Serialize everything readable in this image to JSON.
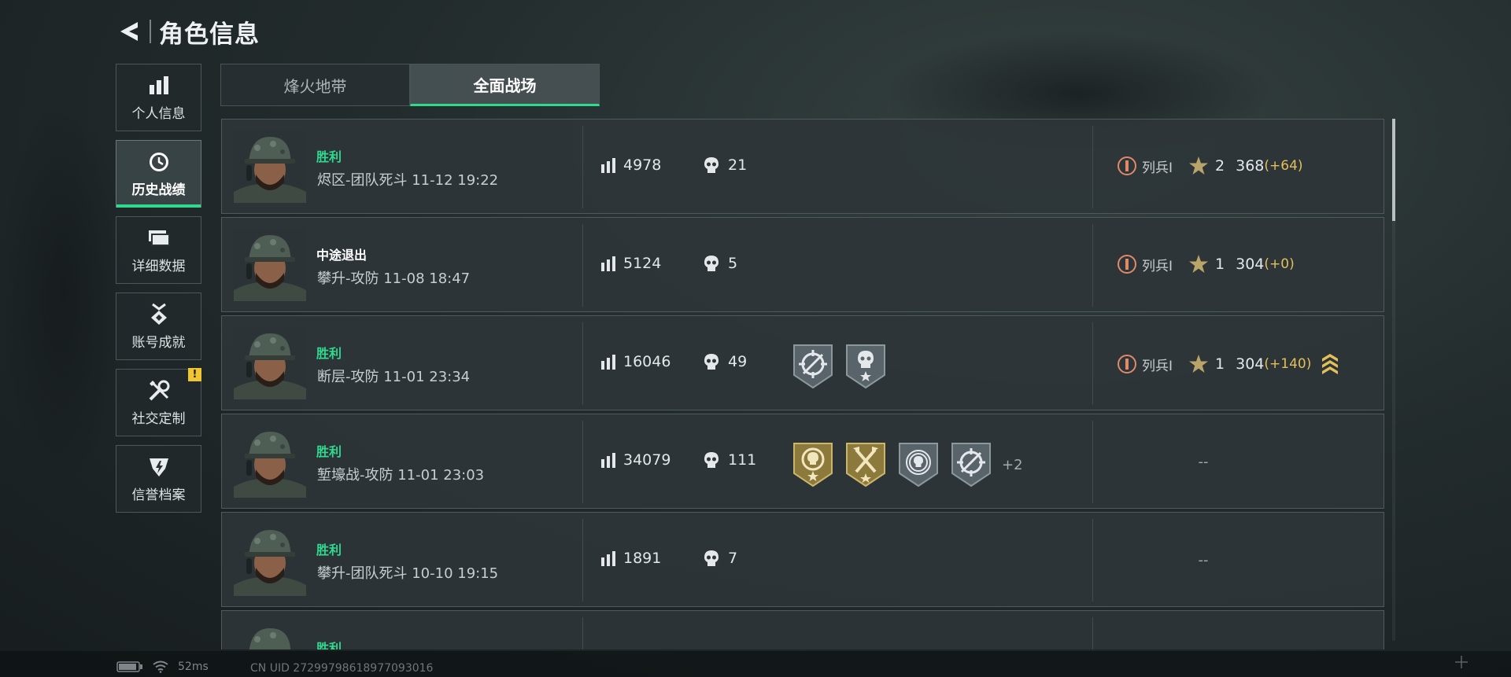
{
  "header": {
    "title": "角色信息"
  },
  "sidebar": {
    "items": [
      {
        "label": "个人信息"
      },
      {
        "label": "历史战绩"
      },
      {
        "label": "详细数据"
      },
      {
        "label": "账号成就"
      },
      {
        "label": "社交定制",
        "badge": "!"
      },
      {
        "label": "信誉档案"
      }
    ],
    "active_index": 1
  },
  "tabs": [
    {
      "label": "烽火地带"
    },
    {
      "label": "全面战场"
    }
  ],
  "active_tab": 1,
  "matches": [
    {
      "result": "胜利",
      "mode": "烬区-团队死斗 11-12 19:22",
      "score": "4978",
      "kills": "21",
      "medals": [],
      "rank": {
        "title": "列兵Ⅰ",
        "stars": "2",
        "points": "368",
        "delta": "(+64)"
      }
    },
    {
      "result": "中途退出",
      "mode": "攀升-攻防 11-08 18:47",
      "score": "5124",
      "kills": "5",
      "medals": [],
      "rank": {
        "title": "列兵Ⅰ",
        "stars": "1",
        "points": "304",
        "delta": "(+0)"
      }
    },
    {
      "result": "胜利",
      "mode": "断层-攻防 11-01 23:34",
      "score": "16046",
      "kills": "49",
      "medals": [
        "crosshair-medal-icon",
        "skull-star-medal-icon"
      ],
      "rank": {
        "title": "列兵Ⅰ",
        "stars": "1",
        "points": "304",
        "delta": "(+140)",
        "promotion": true
      }
    },
    {
      "result": "胜利",
      "mode": "堑壕战-攻防 11-01 23:03",
      "score": "34079",
      "kills": "111",
      "medals": [
        "gold-skull-medal-icon",
        "gold-axes-medal-icon",
        "skull-target-medal-icon",
        "crosshair-medal-icon"
      ],
      "more_medals": "+2",
      "rank_none": "--"
    },
    {
      "result": "胜利",
      "mode": "攀升-团队死斗 10-10 19:15",
      "score": "1891",
      "kills": "7",
      "medals": [],
      "rank_none": "--"
    },
    {
      "result": "胜利"
    }
  ],
  "status": {
    "ping": "52ms",
    "uid": "CN UID 27299798618977093016"
  },
  "colors": {
    "accent": "#2fd98e",
    "gold": "#e3bf5a",
    "alert": "#f0c531"
  },
  "icons": [
    "back-arrow-icon",
    "bar-chart-icon",
    "clock-icon",
    "cards-icon",
    "medal-icon",
    "tools-icon",
    "shield-icon",
    "score-bars-icon",
    "skull-icon",
    "rank-insignia-icon",
    "star-icon",
    "chevron-stripes-icon",
    "battery-icon",
    "wifi-icon"
  ]
}
